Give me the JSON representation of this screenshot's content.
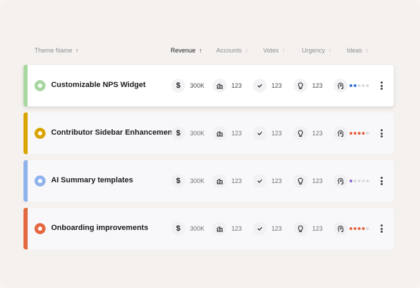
{
  "header": {
    "theme_name": "Theme Name",
    "revenue": "Revenue",
    "accounts": "Accounts",
    "votes": "Votes",
    "urgency": "Urgency",
    "ideas": "Ideas",
    "arrow": "↑"
  },
  "rows": [
    {
      "title": "Customizable NPS Widget",
      "accent": "#a8d8a0",
      "revenue": "300K",
      "accounts": "123",
      "votes": "123",
      "urgency": "123",
      "dot_colors": [
        "#2f6ee0",
        "#2f6ee0",
        "#d8d8de",
        "#d8d8de",
        "#d8d8de"
      ]
    },
    {
      "title": "Contributor Sidebar Enhancements",
      "accent": "#d9a400",
      "revenue": "300K",
      "accounts": "123",
      "votes": "123",
      "urgency": "123",
      "dot_colors": [
        "#e8603c",
        "#e8603c",
        "#e8603c",
        "#e8603c",
        "#d8d8de"
      ]
    },
    {
      "title": "AI Summary templates",
      "accent": "#8fb3ea",
      "revenue": "300K",
      "accounts": "123",
      "votes": "123",
      "urgency": "123",
      "dot_colors": [
        "#8a63c9",
        "#d8d8de",
        "#d8d8de",
        "#d8d8de",
        "#d8d8de"
      ]
    },
    {
      "title": "Onboarding improvements",
      "accent": "#e4683f",
      "revenue": "300K",
      "accounts": "123",
      "votes": "123",
      "urgency": "123",
      "dot_colors": [
        "#e8603c",
        "#e8603c",
        "#e8603c",
        "#e8603c",
        "#d8d8de"
      ]
    }
  ]
}
